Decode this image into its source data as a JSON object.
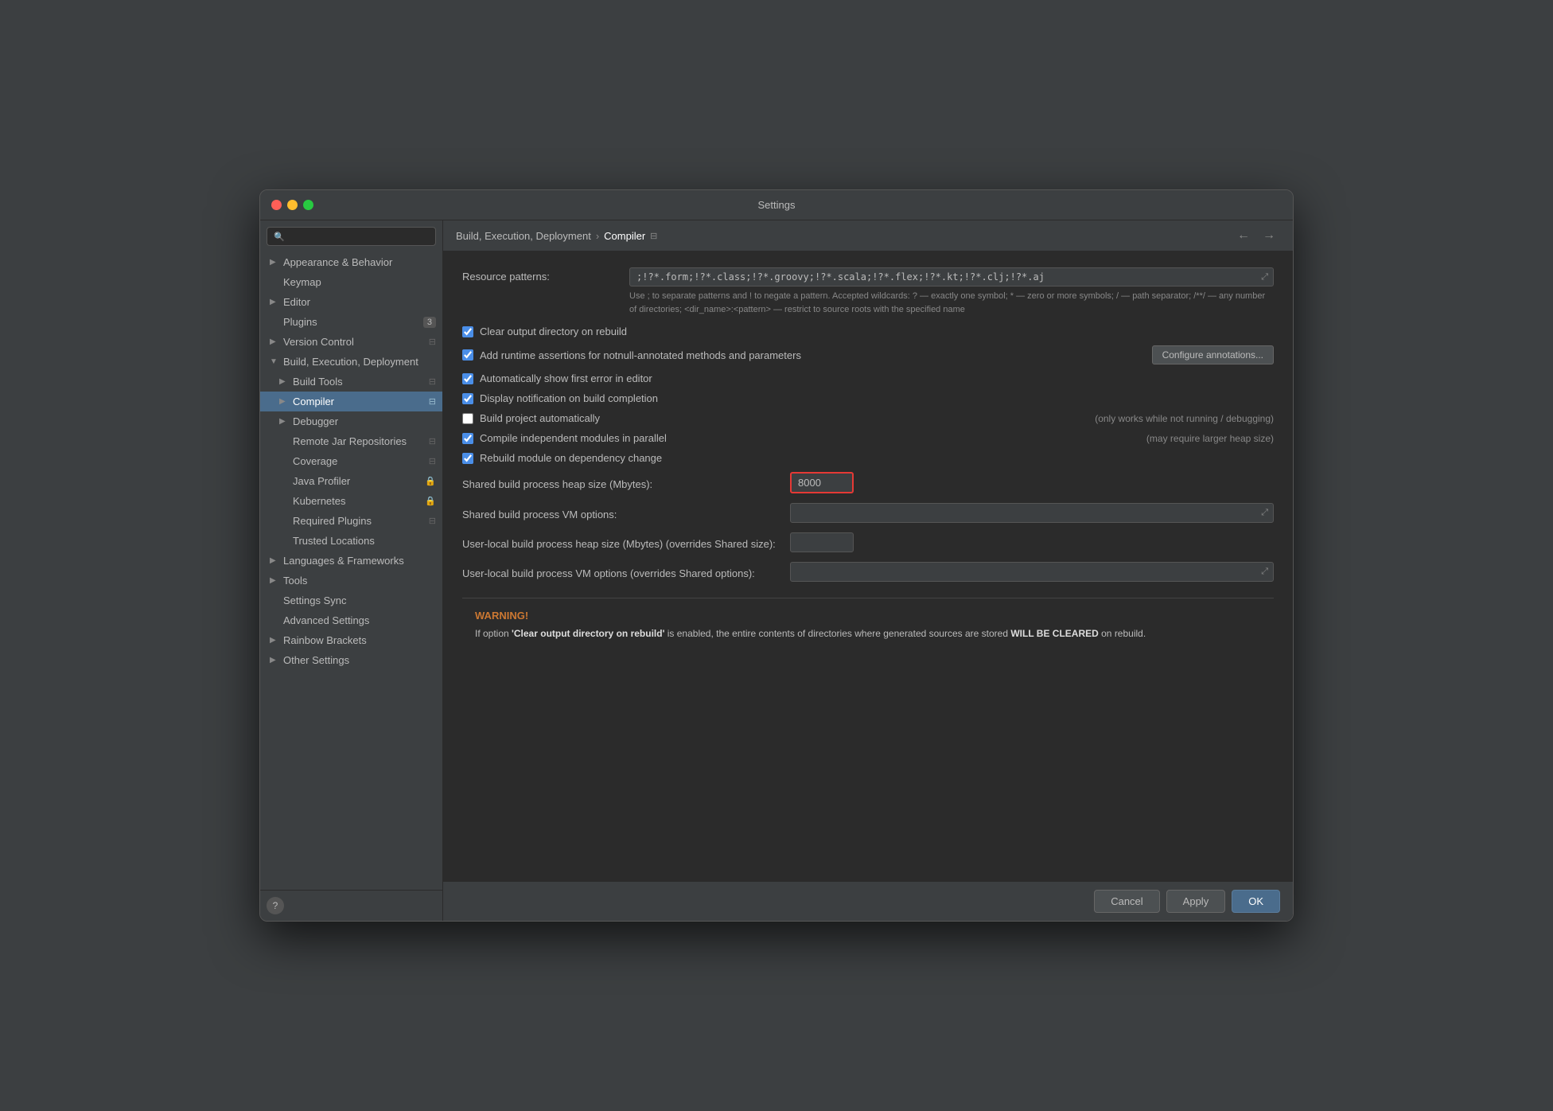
{
  "window": {
    "title": "Settings"
  },
  "sidebar": {
    "search_placeholder": "🔍",
    "items": [
      {
        "id": "appearance",
        "label": "Appearance & Behavior",
        "indent": 0,
        "has_arrow": true,
        "expanded": false
      },
      {
        "id": "keymap",
        "label": "Keymap",
        "indent": 0,
        "has_arrow": false
      },
      {
        "id": "editor",
        "label": "Editor",
        "indent": 0,
        "has_arrow": true,
        "expanded": false
      },
      {
        "id": "plugins",
        "label": "Plugins",
        "indent": 0,
        "has_arrow": false,
        "badge": "3"
      },
      {
        "id": "version-control",
        "label": "Version Control",
        "indent": 0,
        "has_arrow": true,
        "expanded": false,
        "db_icon": true
      },
      {
        "id": "build-exec-deploy",
        "label": "Build, Execution, Deployment",
        "indent": 0,
        "has_arrow": true,
        "expanded": true
      },
      {
        "id": "build-tools",
        "label": "Build Tools",
        "indent": 1,
        "has_arrow": true,
        "expanded": false,
        "db_icon": true
      },
      {
        "id": "compiler",
        "label": "Compiler",
        "indent": 1,
        "has_arrow": true,
        "expanded": false,
        "db_icon": true,
        "selected": true
      },
      {
        "id": "debugger",
        "label": "Debugger",
        "indent": 1,
        "has_arrow": true,
        "expanded": false
      },
      {
        "id": "remote-jar",
        "label": "Remote Jar Repositories",
        "indent": 1,
        "has_arrow": false,
        "db_icon": true
      },
      {
        "id": "coverage",
        "label": "Coverage",
        "indent": 1,
        "has_arrow": false,
        "db_icon": true
      },
      {
        "id": "java-profiler",
        "label": "Java Profiler",
        "indent": 1,
        "has_arrow": false,
        "lock_icon": true
      },
      {
        "id": "kubernetes",
        "label": "Kubernetes",
        "indent": 1,
        "has_arrow": false,
        "lock_icon": true
      },
      {
        "id": "required-plugins",
        "label": "Required Plugins",
        "indent": 1,
        "has_arrow": false,
        "db_icon": true
      },
      {
        "id": "trusted-locations",
        "label": "Trusted Locations",
        "indent": 1,
        "has_arrow": false
      },
      {
        "id": "languages-frameworks",
        "label": "Languages & Frameworks",
        "indent": 0,
        "has_arrow": true,
        "expanded": false
      },
      {
        "id": "tools",
        "label": "Tools",
        "indent": 0,
        "has_arrow": true,
        "expanded": false
      },
      {
        "id": "settings-sync",
        "label": "Settings Sync",
        "indent": 0,
        "has_arrow": false
      },
      {
        "id": "advanced-settings",
        "label": "Advanced Settings",
        "indent": 0,
        "has_arrow": false
      },
      {
        "id": "rainbow-brackets",
        "label": "Rainbow Brackets",
        "indent": 0,
        "has_arrow": true,
        "expanded": false
      },
      {
        "id": "other-settings",
        "label": "Other Settings",
        "indent": 0,
        "has_arrow": true,
        "expanded": false
      }
    ]
  },
  "breadcrumb": {
    "parent": "Build, Execution, Deployment",
    "separator": "›",
    "current": "Compiler",
    "db_icon": "⊟"
  },
  "content": {
    "resource_patterns": {
      "label": "Resource patterns:",
      "value": ";!?*.form;!?*.class;!?*.groovy;!?*.scala;!?*.flex;!?*.kt;!?*.clj;!?*.aj",
      "hint": "Use ; to separate patterns and ! to negate a pattern. Accepted wildcards: ? — exactly one symbol; * — zero or more symbols; / — path separator; /**/ — any number of directories; <dir_name>:<pattern> — restrict to source roots with the specified name"
    },
    "checkboxes": [
      {
        "id": "clear-output",
        "checked": true,
        "label": "Clear output directory on rebuild",
        "hint": ""
      },
      {
        "id": "add-runtime",
        "checked": true,
        "label": "Add runtime assertions for notnull-annotated methods and parameters",
        "hint": "",
        "has_configure_btn": true,
        "configure_label": "Configure annotations..."
      },
      {
        "id": "show-first-error",
        "checked": true,
        "label": "Automatically show first error in editor",
        "hint": ""
      },
      {
        "id": "display-notification",
        "checked": true,
        "label": "Display notification on build completion",
        "hint": ""
      },
      {
        "id": "build-auto",
        "checked": false,
        "label": "Build project automatically",
        "hint": "(only works while not running / debugging)"
      },
      {
        "id": "compile-parallel",
        "checked": true,
        "label": "Compile independent modules in parallel",
        "hint": "(may require larger heap size)"
      },
      {
        "id": "rebuild-dep",
        "checked": true,
        "label": "Rebuild module on dependency change",
        "hint": ""
      }
    ],
    "fields": [
      {
        "id": "shared-heap",
        "label": "Shared build process heap size (Mbytes):",
        "value": "8000",
        "type": "small",
        "highlighted": true
      },
      {
        "id": "shared-vm",
        "label": "Shared build process VM options:",
        "value": "",
        "type": "wide"
      },
      {
        "id": "user-heap",
        "label": "User-local build process heap size (Mbytes) (overrides Shared size):",
        "value": "",
        "type": "small"
      },
      {
        "id": "user-vm",
        "label": "User-local build process VM options (overrides Shared options):",
        "value": "",
        "type": "wide"
      }
    ],
    "warning": {
      "title": "WARNING!",
      "text": "If option 'Clear output directory on rebuild' is enabled, the entire contents of directories where generated sources are stored WILL BE CLEARED on rebuild."
    }
  },
  "footer": {
    "cancel_label": "Cancel",
    "apply_label": "Apply",
    "ok_label": "OK"
  }
}
